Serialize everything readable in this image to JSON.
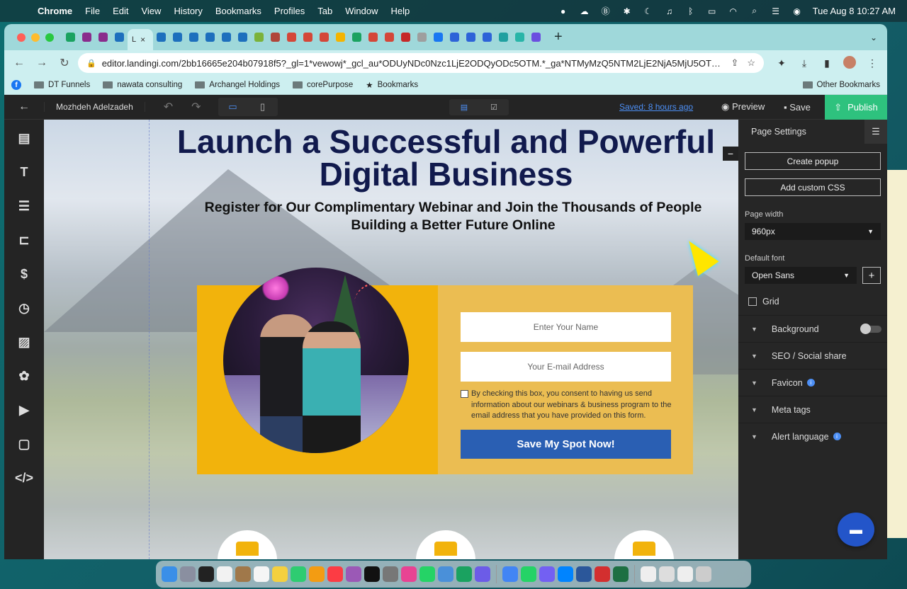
{
  "menubar": {
    "app": "Chrome",
    "items": [
      "File",
      "Edit",
      "View",
      "History",
      "Bookmarks",
      "Profiles",
      "Tab",
      "Window",
      "Help"
    ],
    "clock": "Tue Aug 8  10:27 AM"
  },
  "browser": {
    "active_tab_label": "L",
    "url": "editor.landingi.com/2bb16665e204b07918f5?_gl=1*vewowj*_gcl_au*ODUyNDc0Nzc1LjE2ODQyODc5OTM.*_ga*NTMyMzQ5NTM2LjE2NjA5MjU5OTU.*_ga..."
  },
  "bookmarks": {
    "items": [
      "DT Funnels",
      "nawata consulting",
      "Archangel Holdings",
      "corePurpose",
      "Bookmarks"
    ],
    "other": "Other Bookmarks"
  },
  "editor": {
    "user_name": "Mozhdeh Adelzadeh",
    "saved_status": "Saved: 8 hours ago",
    "preview_label": "Preview",
    "save_label": "Save",
    "publish_label": "Publish"
  },
  "page": {
    "headline": "Launch a Successful and Powerful Digital Business",
    "subheadline": "Register for Our Complimentary Webinar and Join the Thousands of People Building a Better Future Online",
    "form": {
      "name_placeholder": "Enter Your Name",
      "email_placeholder": "Your E-mail Address",
      "consent_text": "By checking this box, you consent to having us send information about our webinars & business program to the email address that you have provided on this form.",
      "cta_label": "Save My Spot Now!"
    }
  },
  "settings": {
    "title": "Page Settings",
    "create_popup": "Create popup",
    "add_css": "Add custom CSS",
    "page_width_label": "Page width",
    "page_width_value": "960px",
    "default_font_label": "Default font",
    "default_font_value": "Open Sans",
    "grid_label": "Grid",
    "sections": [
      "Background",
      "SEO / Social share",
      "Favicon",
      "Meta tags",
      "Alert language"
    ]
  },
  "colors": {
    "publish": "#2ec27e",
    "link": "#4d8ff5",
    "cta": "#2a5fb3",
    "headline": "#111a4d",
    "form_left": "#f2b30c",
    "form_right": "#ebbd52"
  }
}
